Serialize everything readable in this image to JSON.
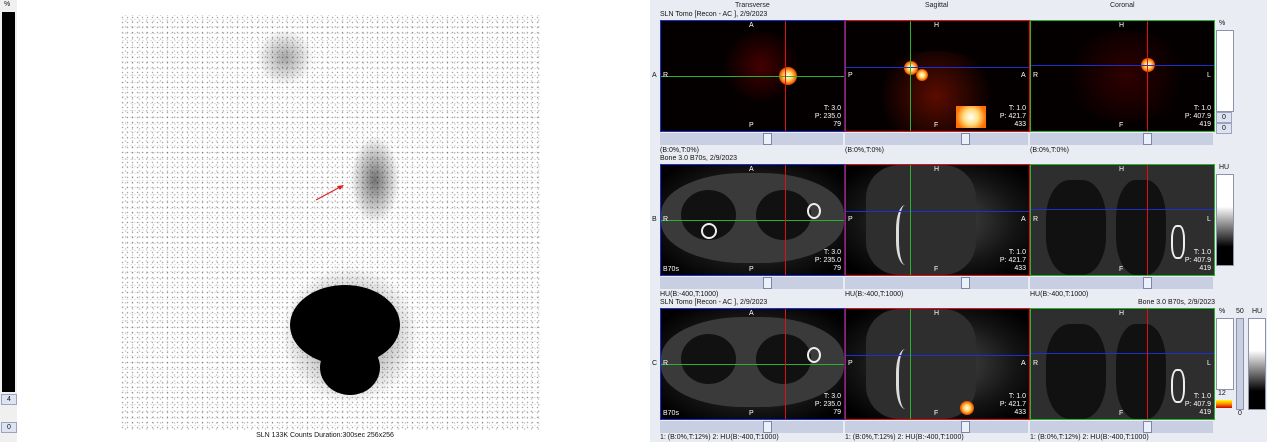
{
  "left": {
    "colorbar_top": "%",
    "colorbar_max": "4",
    "colorbar_min": "0",
    "caption": "SLN 133K Counts Duration:300sec 256x256"
  },
  "right": {
    "headers": {
      "transverse": "Transverse",
      "sagittal": "Sagittal",
      "coronal": "Coronal"
    },
    "row_a": {
      "title": "SLN Tomo [Recon - AC ], 2/9/2023",
      "label": "A",
      "transverse": {
        "top": "A",
        "left": "R",
        "bottom": "P",
        "info": [
          "T: 3.0",
          "P: 235.0",
          "79"
        ]
      },
      "sagittal": {
        "top": "H",
        "left": "P",
        "right": "A",
        "bottom": "F",
        "info": [
          "T: 1.0",
          "P: 421.7",
          "433"
        ]
      },
      "coronal": {
        "top": "H",
        "left": "R",
        "right": "L",
        "bottom": "F",
        "info": [
          "T: 1.0",
          "P: 407.9",
          "419"
        ]
      },
      "wl": [
        "(B:0%,T:0%)",
        "(B:0%,T:0%)",
        "(B:0%,T:0%)"
      ],
      "colorbar_top": "%",
      "colorbar_values": [
        "0",
        "0"
      ]
    },
    "row_b": {
      "title": "Bone  3.0  B70s, 2/9/2023",
      "label": "B",
      "kernel": "B70s",
      "transverse": {
        "top": "A",
        "left": "R",
        "bottom": "P",
        "info": [
          "T: 3.0",
          "P: 235.0",
          "79"
        ]
      },
      "sagittal": {
        "top": "H",
        "left": "P",
        "right": "A",
        "bottom": "F",
        "info": [
          "T: 1.0",
          "P: 421.7",
          "433"
        ]
      },
      "coronal": {
        "top": "H",
        "left": "R",
        "right": "L",
        "bottom": "F",
        "info": [
          "T: 1.0",
          "P: 407.9",
          "419"
        ]
      },
      "wl": [
        "HU(B:-400,T:1000)",
        "HU(B:-400,T:1000)",
        "HU(B:-400,T:1000)"
      ],
      "colorbar_top": "HU"
    },
    "row_c": {
      "title_left": "SLN Tomo [Recon - AC ], 2/9/2023",
      "title_right": "Bone  3.0  B70s, 2/9/2023",
      "label": "C",
      "kernel": "B70s",
      "transverse": {
        "top": "A",
        "left": "R",
        "bottom": "P",
        "info": [
          "T: 3.0",
          "P: 235.0",
          "79"
        ]
      },
      "sagittal": {
        "top": "H",
        "left": "P",
        "right": "A",
        "bottom": "F",
        "info": [
          "T: 1.0",
          "P: 421.7",
          "433"
        ]
      },
      "coronal": {
        "top": "H",
        "left": "R",
        "right": "L",
        "bottom": "F",
        "info": [
          "T: 1.0",
          "P: 407.9",
          "419"
        ]
      },
      "wl": [
        "1: (B:0%,T:12%)   2: HU(B:-400,T:1000)",
        "1: (B:0%,T:12%)   2: HU(B:-400,T:1000)",
        "1: (B:0%,T:12%)   2: HU(B:-400,T:1000)"
      ],
      "colorbar_pct": "%",
      "colorbar_hu": "HU",
      "pct_max": "50",
      "pct_value": "12",
      "pct_min": "0"
    }
  },
  "colors": {
    "blue": "#1c2fd0",
    "red": "#dd1111",
    "green": "#2db02d",
    "arrow": "#e02020"
  }
}
